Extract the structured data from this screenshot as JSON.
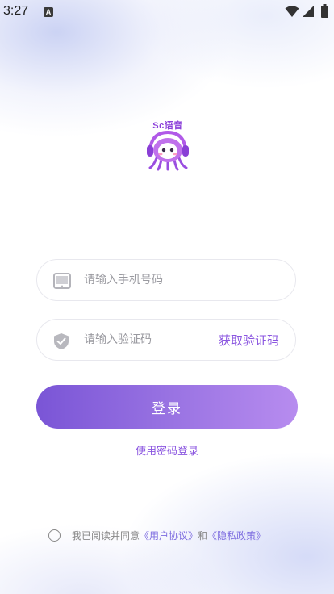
{
  "status_bar": {
    "time": "3:27",
    "notification_icon": "A",
    "icons": [
      "wifi-icon",
      "signal-icon",
      "battery-icon"
    ]
  },
  "logo": {
    "text": "Sc语音",
    "mascot_icon": "headphone-mascot-icon"
  },
  "phone_field": {
    "placeholder": "请输入手机号码",
    "value": "",
    "icon": "phone-icon"
  },
  "code_field": {
    "placeholder": "请输入验证码",
    "value": "",
    "icon": "shield-icon",
    "get_code_label": "获取验证码"
  },
  "login_button": {
    "label": "登录"
  },
  "password_login": {
    "label": "使用密码登录"
  },
  "agreement": {
    "checked": false,
    "prefix": "我已阅读并同意",
    "user_agreement": "《用户协议》",
    "conjunction": "和",
    "privacy_policy": "《隐私政策》"
  },
  "colors": {
    "accent": "#8b56e0",
    "button_gradient_start": "#7a55d6",
    "button_gradient_end": "#b78cef",
    "link": "#7d6ce0"
  }
}
